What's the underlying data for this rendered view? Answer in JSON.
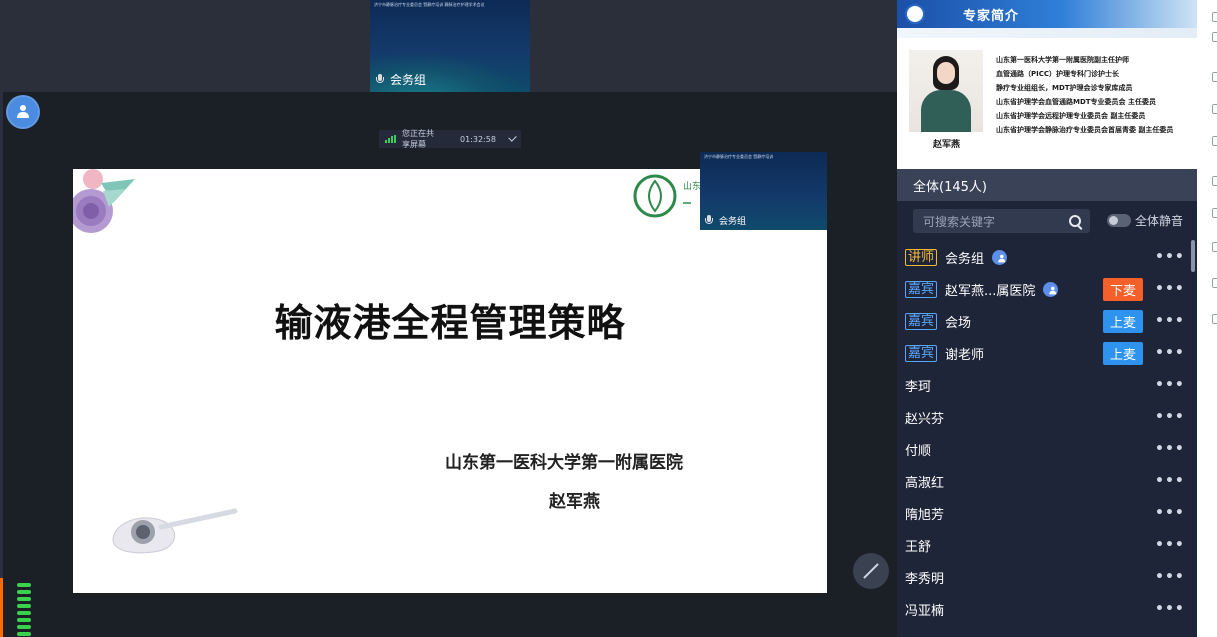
{
  "stage": {
    "top_thumbnail_label": "会务组",
    "top_thumbnail_small_text": "济宁市静脉治疗专业委员会 暨静疗培训 静脉治疗护理学术会议",
    "share_bar_text": "您正在共享屏幕",
    "share_bar_time": "01:32:58",
    "pip_label": "会务组",
    "pip_small_text": "济宁市静脉治疗专业委员会 暨静疗培训"
  },
  "slide": {
    "title": "输液港全程管理策略",
    "hospital": "山东第一医科大学第一附属医院",
    "author": "赵军燕",
    "logo_text": "山东"
  },
  "expert": {
    "title": "专家简介",
    "name": "赵军燕",
    "lines": [
      "山东第一医科大学第一附属医院副主任护师",
      "血管通路（PICC）护理专科门诊护士长",
      "静疗专业组组长，MDT护理会诊专家库成员",
      "山东省护理学会血管通路MDT专业委员会 主任委员",
      "山东省护理学会远程护理专业委员会 副主任委员",
      "山东省护理学会静脉治疗专业委员会首届青委 副主任委员"
    ]
  },
  "members": {
    "header": "全体(145人)",
    "search_placeholder": "可搜索关键字",
    "mute_all_label": "全体静音",
    "more_label": "•••",
    "list": [
      {
        "tag": "讲师",
        "name": "会务组",
        "button": ""
      },
      {
        "tag": "嘉宾",
        "name": "赵军燕...属医院",
        "button": "下麦"
      },
      {
        "tag": "嘉宾",
        "name": "会场",
        "button": "上麦"
      },
      {
        "tag": "嘉宾",
        "name": "谢老师",
        "button": "上麦"
      },
      {
        "tag": "",
        "name": "李珂",
        "button": ""
      },
      {
        "tag": "",
        "name": "赵兴芬",
        "button": ""
      },
      {
        "tag": "",
        "name": "付顺",
        "button": ""
      },
      {
        "tag": "",
        "name": "高淑红",
        "button": ""
      },
      {
        "tag": "",
        "name": "隋旭芳",
        "button": ""
      },
      {
        "tag": "",
        "name": "王舒",
        "button": ""
      },
      {
        "tag": "",
        "name": "李秀明",
        "button": ""
      },
      {
        "tag": "",
        "name": "冯亚楠",
        "button": ""
      }
    ]
  },
  "colors": {
    "tag_lecturer": "#f5b93a",
    "tag_guest": "#5aa6ff",
    "mic_down": "#f5602a",
    "mic_up": "#2d93ee",
    "audio_meter": "#3ad14d"
  }
}
